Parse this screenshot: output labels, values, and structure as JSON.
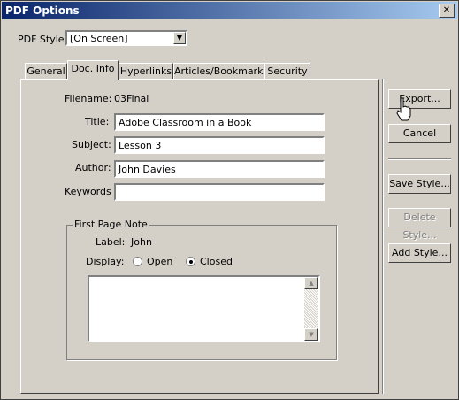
{
  "window": {
    "title": "PDF Options",
    "close_glyph": "✕"
  },
  "style": {
    "label": "PDF Style:",
    "value": "[On Screen]"
  },
  "tabs": [
    {
      "label": "General"
    },
    {
      "label": "Doc. Info"
    },
    {
      "label": "Hyperlinks"
    },
    {
      "label": "Articles/Bookmarks"
    },
    {
      "label": "Security"
    }
  ],
  "doc_info": {
    "filename_label": "Filename:",
    "filename_value": "03Final",
    "title_label": "Title:",
    "title_value": "Adobe Classroom in a Book",
    "subject_label": "Subject:",
    "subject_value": "Lesson 3",
    "author_label": "Author:",
    "author_value": "John Davies",
    "keywords_label": "Keywords",
    "keywords_value": ""
  },
  "note": {
    "group_label": "First Page Note",
    "label_label": "Label:",
    "label_value": "John",
    "display_label": "Display:",
    "open_label": "Open",
    "closed_label": "Closed",
    "selected": "Closed",
    "text": ""
  },
  "buttons": {
    "export": "Export...",
    "cancel": "Cancel",
    "save_style": "Save Style...",
    "delete_style": "Delete Style...",
    "add_style": "Add Style..."
  }
}
